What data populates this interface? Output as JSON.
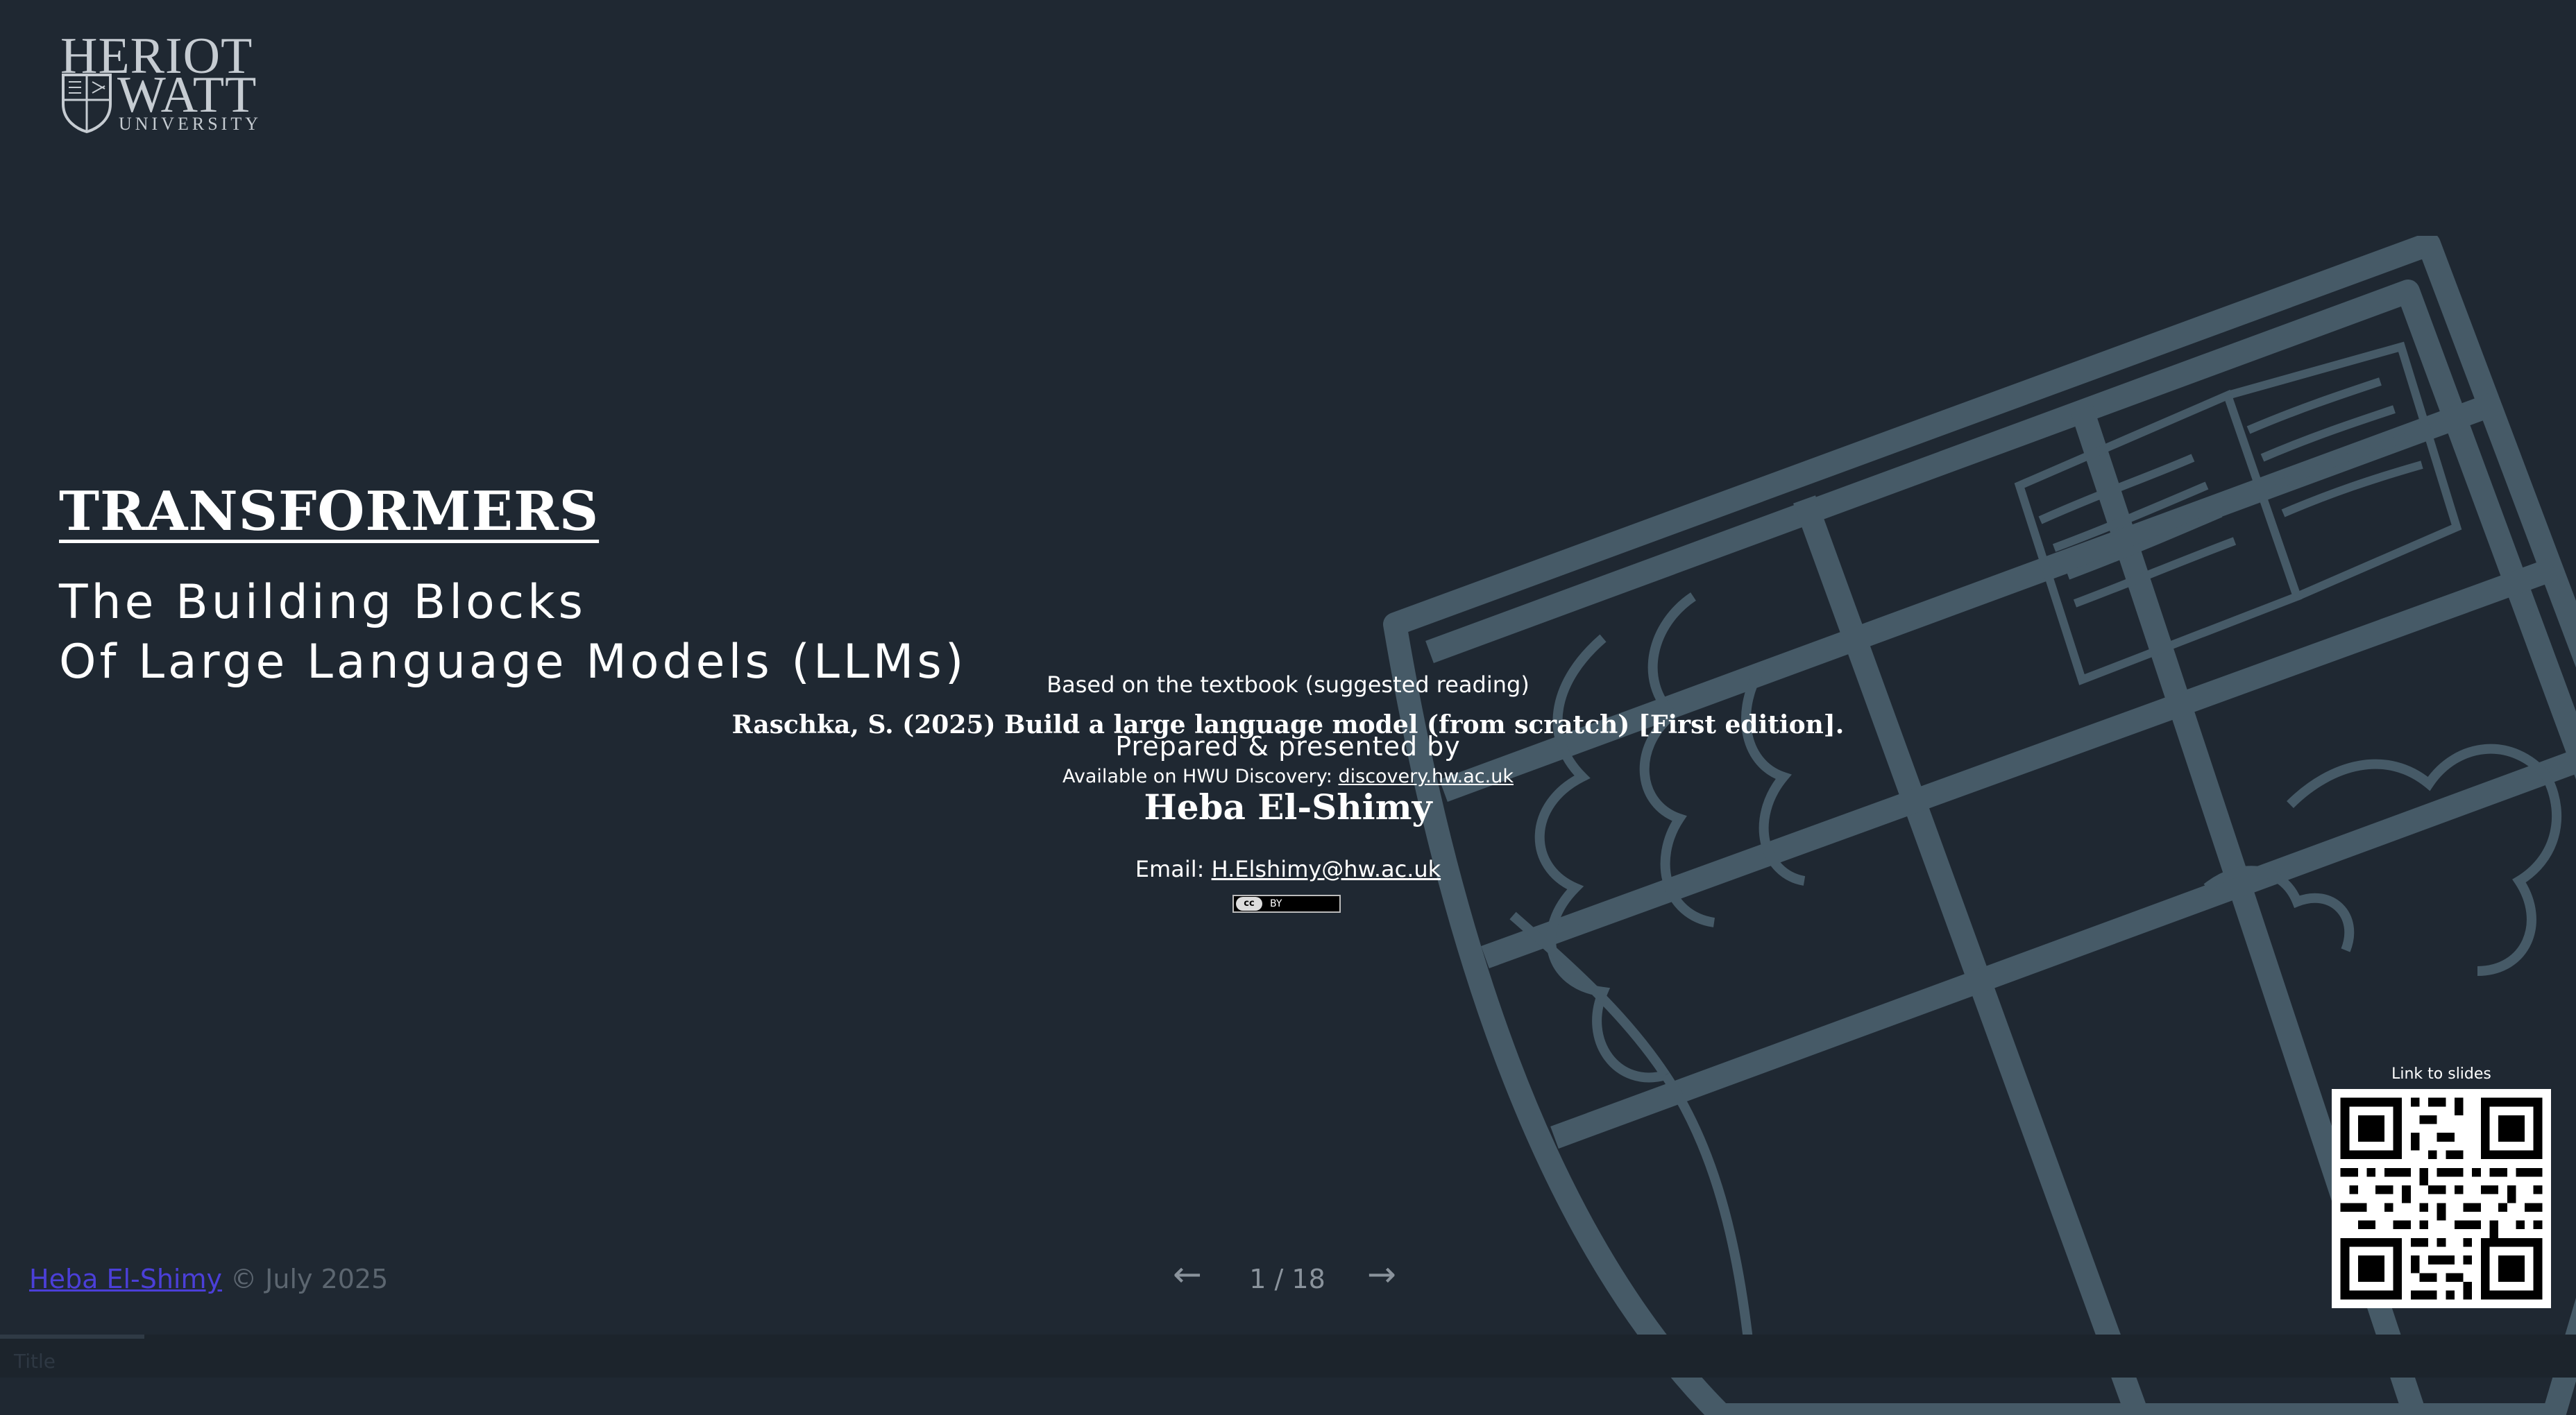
{
  "logo": {
    "line1": "HERIOT",
    "line2": "WATT",
    "line3": "UNIVERSITY"
  },
  "slide": {
    "title": "TRANSFORMERS",
    "subtitle_line1": "The Building Blocks",
    "subtitle_line2": "Of Large Language Models (LLMs)",
    "based_on": "Based on the textbook (suggested reading)",
    "citation": "Raschka, S. (2025) Build a large language model (from scratch) [First edition].",
    "prepared_by": "Prepared & presented by",
    "available_prefix": "Available on HWU Discovery: ",
    "available_link": "discovery.hw.ac.uk",
    "presenter": "Heba El-Shimy",
    "email_prefix": "Email: ",
    "email_link": "H.Elshimy@hw.ac.uk",
    "license_label": "BY",
    "qr_label": "Link to slides"
  },
  "footer": {
    "author_link": "Heba El-Shimy",
    "copyright": " © July 2025"
  },
  "navigation": {
    "prev_icon": "←",
    "next_icon": "→",
    "page": "1 / 18",
    "progress": 0.056
  },
  "section": {
    "label": "Title"
  },
  "colors": {
    "background": "#1f2832",
    "crest": "#465a67",
    "footer_link": "#4b3fd8",
    "muted_text": "#5c6670"
  }
}
